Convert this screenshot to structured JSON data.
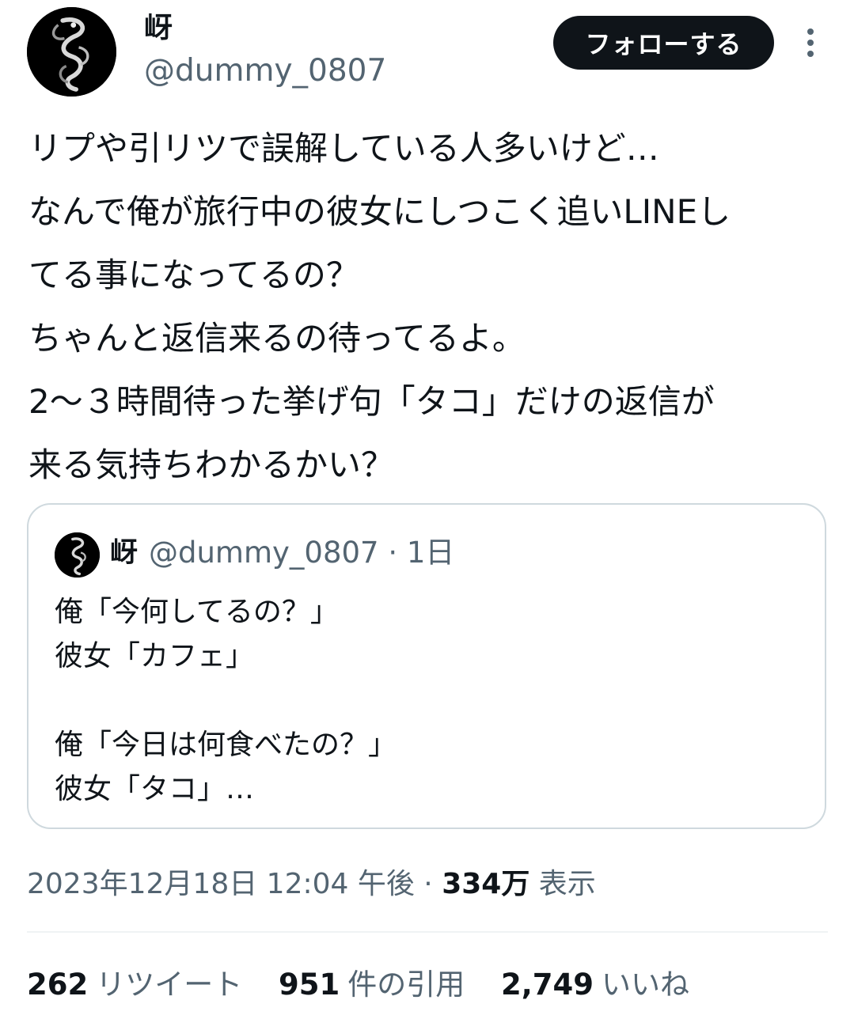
{
  "author": {
    "name": "岈",
    "handle": "@dummy_0807",
    "avatar_icon": "smoke-dragon-avatar"
  },
  "actions": {
    "follow_label": "フォローする",
    "more_icon": "more-vertical-icon"
  },
  "tweet": {
    "text": "リプや引リツで誤解している人多いけど…\nなんで俺が旅行中の彼女にしつこく追いLINEし\nてる事になってるの？\nちゃんと返信来るの待ってるよ。\n2～３時間待った挙げ句「タコ」だけの返信が\n来る気持ちわかるかい？"
  },
  "quote": {
    "name": "岈",
    "meta": "@dummy_0807 · 1日",
    "text": "俺「今何してるの？」\n彼女「カフェ」\n\n俺「今日は何食べたの？」\n彼女「タコ」…"
  },
  "meta": {
    "timestamp": "2023年12月18日 12:04 午後 · ",
    "views_count": "334万",
    "views_label": " 表示"
  },
  "stats": {
    "retweets_count": "262",
    "retweets_label": "リツイート",
    "quotes_count": "951",
    "quotes_label": "件の引用",
    "likes_count": "2,749",
    "likes_label": "いいね"
  },
  "colors": {
    "text_primary": "#0f1419",
    "text_secondary": "#536471",
    "border": "#cfd9de",
    "button_bg": "#0f1419"
  }
}
